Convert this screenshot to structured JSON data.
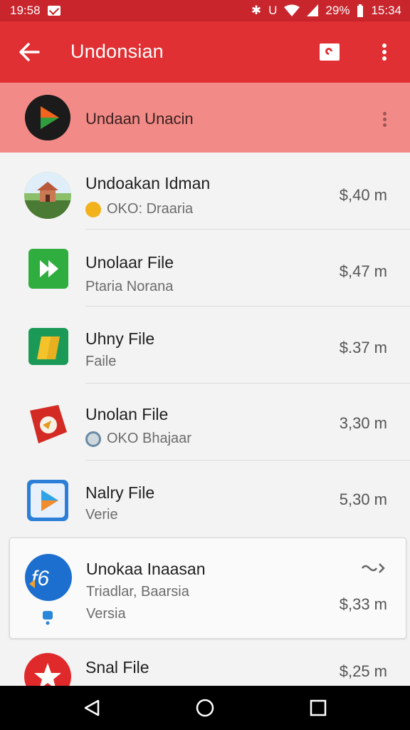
{
  "status_bar": {
    "time_left": "19:58",
    "battery": "29%",
    "clock": "15:34"
  },
  "app_bar": {
    "title": "Undonsian"
  },
  "now_item": {
    "label": "Undaan Unacin"
  },
  "items": [
    {
      "title": "Undoakan Idman",
      "subtitle": "OKO: Draaria",
      "size": "$,40 m"
    },
    {
      "title": "Unolaar File",
      "subtitle": "Ptaria Norana",
      "size": "$,47 m"
    },
    {
      "title": "Uhny File",
      "subtitle": "Faile",
      "size": "$.37 m"
    },
    {
      "title": "Unolan File",
      "subtitle": "OKO Bhajaar",
      "size": "3,30 m"
    },
    {
      "title": "Nalry File",
      "subtitle": "Verie",
      "size": "5,30 m"
    }
  ],
  "card": {
    "title": "Unokaa Inaasan",
    "line1": "Triadlar, Baarsia",
    "line2": "Versia",
    "size": "$,33 m"
  },
  "last_item": {
    "title": "Snal File",
    "size": "$,25 m"
  },
  "colors": {
    "appbar": "#e03034",
    "statusbar": "#c9252c",
    "highlight": "#f28b87"
  }
}
